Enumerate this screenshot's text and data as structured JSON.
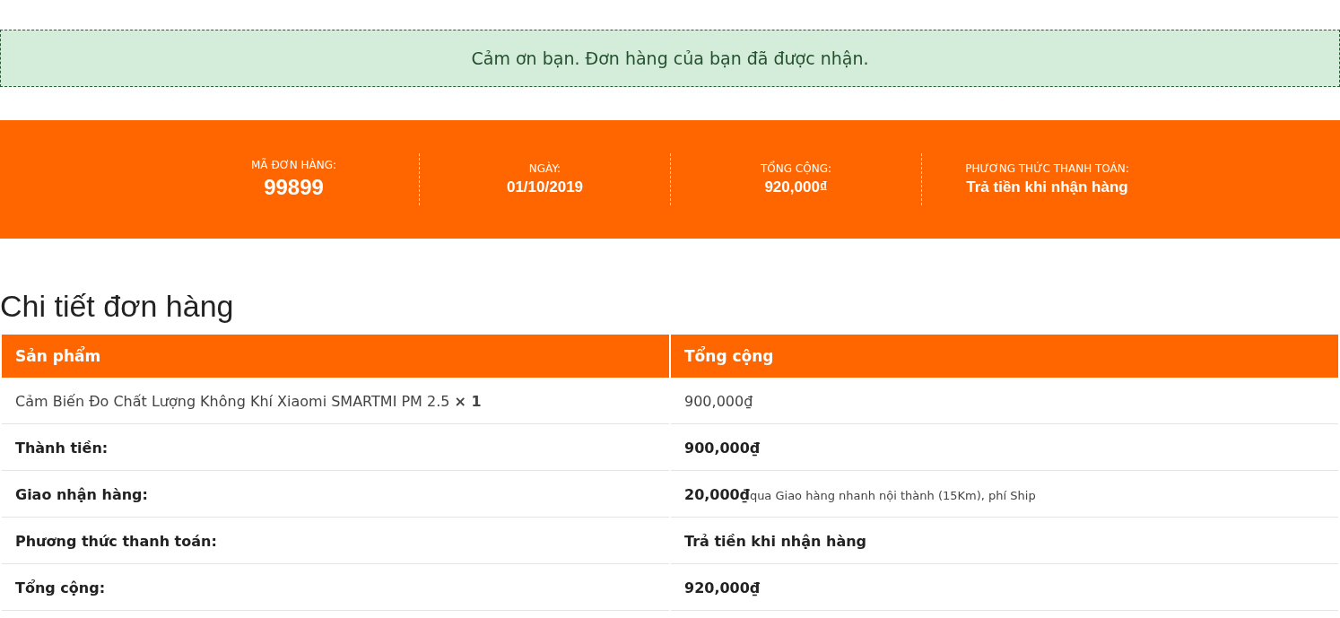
{
  "notice": "Cảm ơn bạn. Đơn hàng của bạn đã được nhận.",
  "overview": [
    {
      "label": "MÃ ĐƠN HÀNG:",
      "value": "99899",
      "kind": "large"
    },
    {
      "label": "NGÀY:",
      "value": "01/10/2019",
      "kind": "normal"
    },
    {
      "label": "TỔNG CỘNG:",
      "value": "920,000₫",
      "kind": "normal"
    },
    {
      "label": "PHƯƠNG THỨC THANH TOÁN:",
      "value": "Trả tiền khi nhận hàng",
      "kind": "normal"
    }
  ],
  "details": {
    "title": "Chi tiết đơn hàng",
    "columns": [
      "Sản phẩm",
      "Tổng cộng"
    ],
    "rows": [
      {
        "kind": "item",
        "label": "Cảm Biến Đo Chất Lượng Không Khí Xiaomi SMARTMI PM 2.5 **× 1**",
        "value": "900,000₫"
      },
      {
        "kind": "total",
        "label": "Thành tiền:",
        "value": "900,000₫"
      },
      {
        "kind": "total",
        "label": "Giao nhận hàng:",
        "value": "20,000₫",
        "note": "qua Giao hàng nhanh nội thành (15Km), phí Ship"
      },
      {
        "kind": "total",
        "label": "Phương thức thanh toán:",
        "value": "Trả tiền khi nhận hàng"
      },
      {
        "kind": "total",
        "label": "Tổng cộng:",
        "value": "920,000₫"
      }
    ]
  }
}
